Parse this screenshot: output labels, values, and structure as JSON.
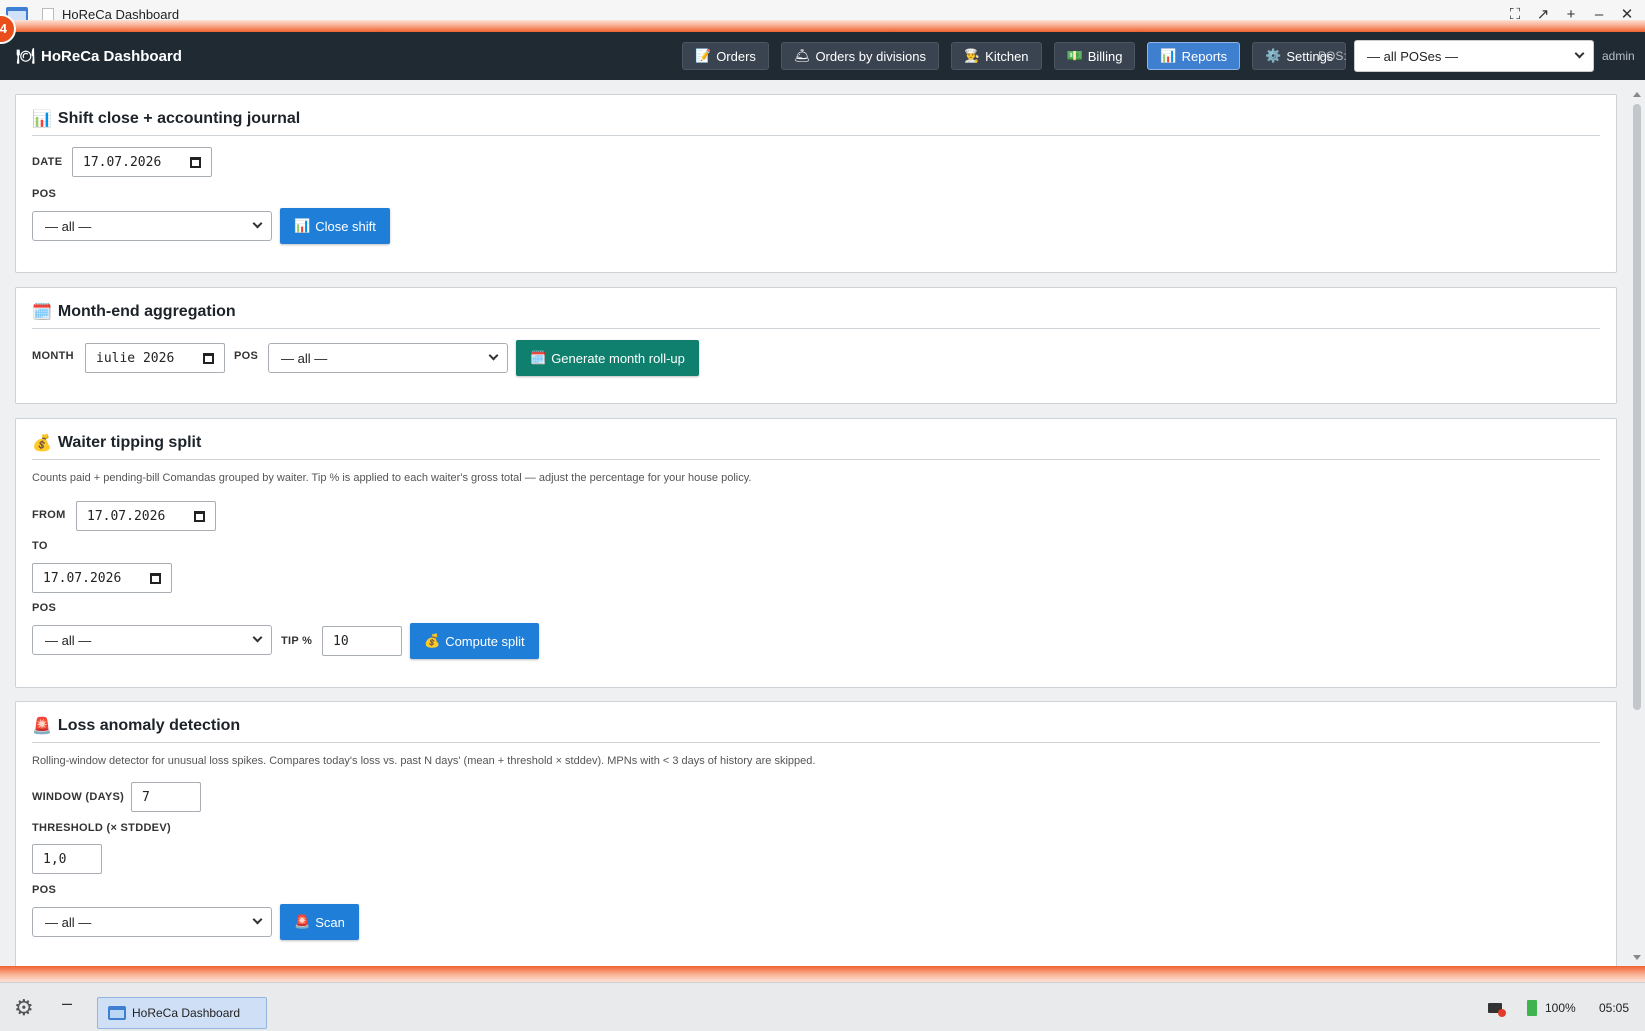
{
  "window": {
    "title": "HoReCa Dashboard",
    "badge": "4"
  },
  "nav": {
    "brand": "HoReCa Dashboard",
    "buttons": [
      {
        "icon": "📝",
        "label": "Orders"
      },
      {
        "icon": "🛎",
        "label": "Orders by divisions"
      },
      {
        "icon": "👨‍🍳",
        "label": "Kitchen"
      },
      {
        "icon": "💵",
        "label": "Billing"
      },
      {
        "icon": "📊",
        "label": "Reports",
        "active": true
      },
      {
        "icon": "⚙️",
        "label": "Settings"
      }
    ],
    "pos_label": "POS:",
    "pos_value": "— all POSes —",
    "user": "admin"
  },
  "shift_close": {
    "icon": "📊",
    "title": "Shift close + accounting journal",
    "date_label": "DATE",
    "date_value": "17.07.2026",
    "pos_label": "POS",
    "pos_value": "— all —",
    "button_icon": "📊",
    "button_label": "Close shift"
  },
  "month_end": {
    "icon": "🗓️",
    "title": "Month-end aggregation",
    "month_label": "MONTH",
    "month_value": "iulie 2026",
    "pos_label": "POS",
    "pos_value": "— all —",
    "button_icon": "🗓️",
    "button_label": "Generate month roll-up"
  },
  "tipping": {
    "icon": "💰",
    "title": "Waiter tipping split",
    "description": "Counts paid + pending-bill Comandas grouped by waiter. Tip % is applied to each waiter's gross total — adjust the percentage for your house policy.",
    "from_label": "FROM",
    "from_value": "17.07.2026",
    "to_label": "TO",
    "to_value": "17.07.2026",
    "pos_label": "POS",
    "pos_value": "— all —",
    "tip_label": "TIP %",
    "tip_value": "10",
    "button_icon": "💰",
    "button_label": "Compute split"
  },
  "loss": {
    "icon": "🚨",
    "title": "Loss anomaly detection",
    "description": "Rolling-window detector for unusual loss spikes. Compares today's loss vs. past N days' (mean + threshold × stddev). MPNs with < 3 days of history are skipped.",
    "window_label": "WINDOW (DAYS)",
    "window_value": "7",
    "threshold_label": "THRESHOLD (× STDDEV)",
    "threshold_value": "1,0",
    "pos_label": "POS",
    "pos_value": "— all —",
    "button_icon": "🚨",
    "button_label": "Scan"
  },
  "taskbar": {
    "task_label": "HoReCa Dashboard",
    "battery": "100%",
    "clock": "05:05"
  }
}
